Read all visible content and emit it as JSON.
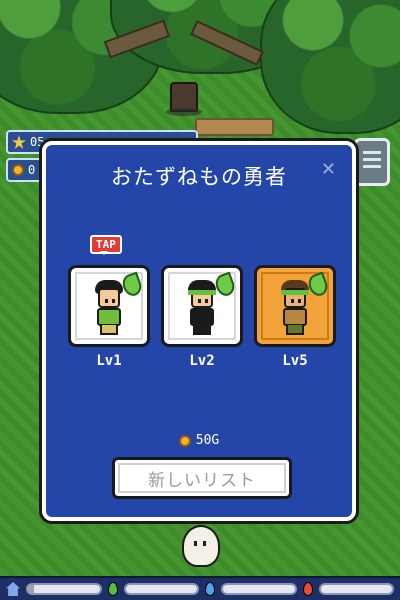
{
  "hud": {
    "stars": "05",
    "coins": "0"
  },
  "dialog": {
    "title": "おたずねもの勇者",
    "close_icon": "close-icon",
    "tap_hint": "TAP",
    "heroes": [
      {
        "name": "hero-1",
        "level": "Lv1",
        "element": "leaf",
        "highlight": false
      },
      {
        "name": "hero-2",
        "level": "Lv2",
        "element": "leaf",
        "highlight": false
      },
      {
        "name": "hero-3",
        "level": "Lv5",
        "element": "leaf",
        "highlight": true
      }
    ],
    "price": "50G",
    "new_list_label": "新しいリスト"
  },
  "bottom_bar": {
    "icons": [
      "home-icon",
      "green-drop-icon",
      "blue-drop-icon",
      "red-drop-icon"
    ],
    "progress": [
      0.08,
      0.0,
      0.0,
      0.0
    ]
  },
  "colors": {
    "panel_blue": "#2346a8",
    "highlight_gold": "#f2a33a",
    "tap_red": "#e23b3b"
  }
}
